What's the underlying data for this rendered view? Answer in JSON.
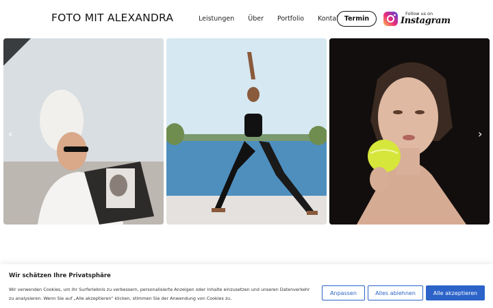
{
  "header": {
    "logo": "FOTO MIT ALEXANDRA",
    "nav": [
      "Leistungen",
      "Über",
      "Portfolio",
      "Kontakt"
    ],
    "cta_label": "Termin",
    "instagram": {
      "follow_text": "Follow us on",
      "name": "Instagram"
    }
  },
  "gallery": {
    "prev_arrow": "‹",
    "next_arrow": "›"
  },
  "cookie": {
    "title": "Wir schätzen Ihre Privatsphäre",
    "text": "Wir verwenden Cookies, um Ihr Surferlebnis zu verbessern, personalisierte Anzeigen oder Inhalte einzusetzen und unseren Datenverkehr zu analysieren. Wenn Sie auf „Alle akzeptieren“ klicken, stimmen Sie der Anwendung von Cookies zu.",
    "buttons": {
      "customize": "Anpassen",
      "reject": "Alles ablehnen",
      "accept": "Alle akzeptieren"
    }
  },
  "colors": {
    "accent": "#2b63c9",
    "text": "#111111"
  }
}
